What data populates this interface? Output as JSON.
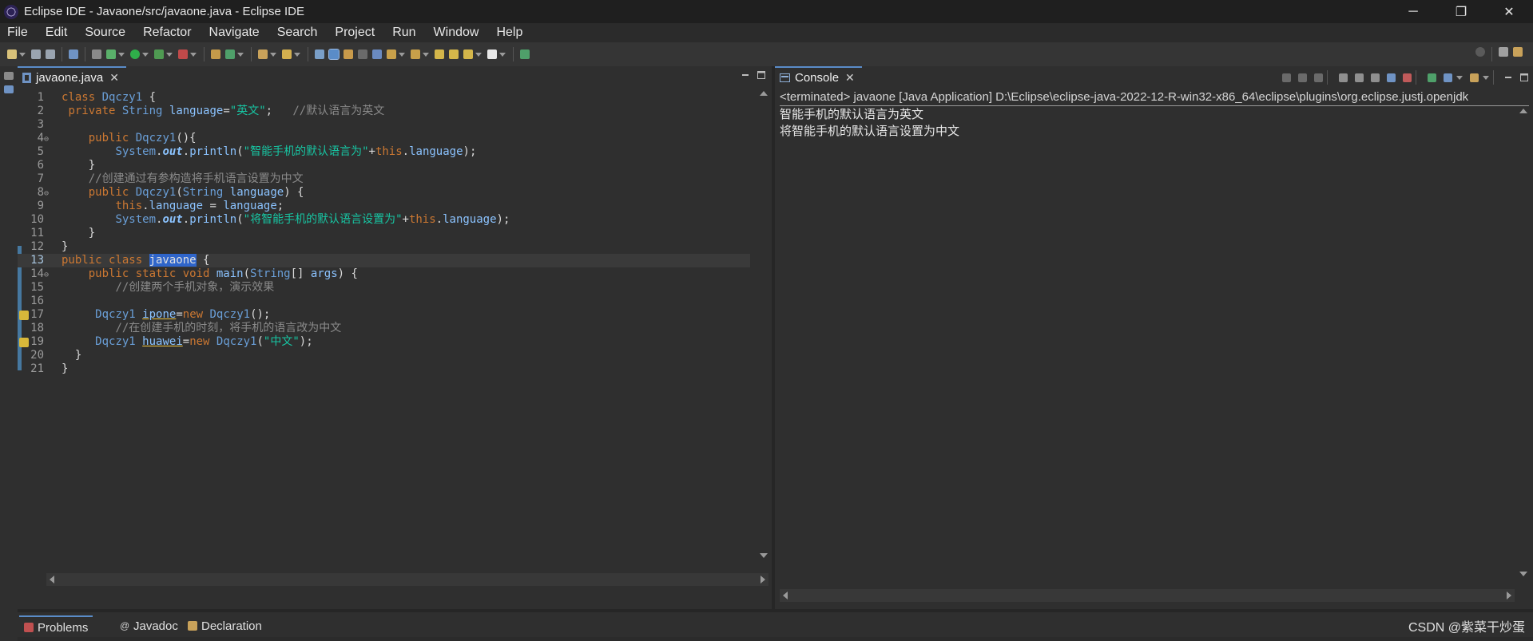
{
  "window": {
    "title": "Eclipse IDE - Javaone/src/javaone.java - Eclipse IDE",
    "min": "─",
    "restore": "❐",
    "close": "✕"
  },
  "menu": [
    "File",
    "Edit",
    "Source",
    "Refactor",
    "Navigate",
    "Search",
    "Project",
    "Run",
    "Window",
    "Help"
  ],
  "editor": {
    "tab_label": "javaone.java",
    "tab_close": "✕"
  },
  "console": {
    "tab_label": "Console",
    "tab_close": "✕",
    "header": "<terminated> javaone [Java Application] D:\\Eclipse\\eclipse-java-2022-12-R-win32-x86_64\\eclipse\\plugins\\org.eclipse.justj.openjdk",
    "output": [
      "智能手机的默认语言为英文",
      "将智能手机的默认语言设置为中文"
    ]
  },
  "bottom_tabs": [
    {
      "label": "Problems",
      "icon": "problems-icon"
    },
    {
      "label": "Javadoc",
      "icon": "at-icon"
    },
    {
      "label": "Declaration",
      "icon": "declaration-icon"
    }
  ],
  "watermark": "CSDN @紫菜干炒蛋",
  "code": [
    {
      "n": "1",
      "segs": [
        [
          "kw",
          "class "
        ],
        [
          "ty",
          "Dqczy1"
        ],
        [
          "",
          " {"
        ]
      ]
    },
    {
      "n": "2",
      "segs": [
        [
          "",
          " "
        ],
        [
          "kw",
          "private "
        ],
        [
          "ty",
          "String "
        ],
        [
          "fld",
          "language"
        ],
        [
          "",
          "="
        ],
        [
          "str",
          "\"英文\""
        ],
        [
          "",
          ";   "
        ],
        [
          "cm",
          "//默认语言为英文"
        ]
      ]
    },
    {
      "n": "3",
      "segs": []
    },
    {
      "n": "4",
      "fold": true,
      "segs": [
        [
          "",
          "    "
        ],
        [
          "kw",
          "public "
        ],
        [
          "ty",
          "Dqczy1"
        ],
        [
          "",
          "(){"
        ]
      ]
    },
    {
      "n": "5",
      "segs": [
        [
          "",
          "        "
        ],
        [
          "ty",
          "System"
        ],
        [
          "",
          "."
        ],
        [
          "stat",
          "out"
        ],
        [
          "",
          "."
        ],
        [
          "fld",
          "println"
        ],
        [
          "",
          "("
        ],
        [
          "str",
          "\"智能手机的默认语言为\""
        ],
        [
          "",
          "+"
        ],
        [
          "kw",
          "this"
        ],
        [
          "",
          "."
        ],
        [
          "fld",
          "language"
        ],
        [
          "",
          ");"
        ]
      ]
    },
    {
      "n": "6",
      "segs": [
        [
          "",
          "    }"
        ]
      ]
    },
    {
      "n": "7",
      "segs": [
        [
          "",
          "    "
        ],
        [
          "cm",
          "//创建通过有参构造将手机语言设置为中文"
        ]
      ]
    },
    {
      "n": "8",
      "fold": true,
      "segs": [
        [
          "",
          "    "
        ],
        [
          "kw",
          "public "
        ],
        [
          "ty",
          "Dqczy1"
        ],
        [
          "",
          "("
        ],
        [
          "ty",
          "String "
        ],
        [
          "fld",
          "language"
        ],
        [
          "",
          ") {"
        ]
      ]
    },
    {
      "n": "9",
      "segs": [
        [
          "",
          "        "
        ],
        [
          "kw",
          "this"
        ],
        [
          "",
          "."
        ],
        [
          "fld",
          "language"
        ],
        [
          "",
          " = "
        ],
        [
          "fld",
          "language"
        ],
        [
          "",
          ";"
        ]
      ]
    },
    {
      "n": "10",
      "segs": [
        [
          "",
          "        "
        ],
        [
          "ty",
          "System"
        ],
        [
          "",
          "."
        ],
        [
          "stat",
          "out"
        ],
        [
          "",
          "."
        ],
        [
          "fld",
          "println"
        ],
        [
          "",
          "("
        ],
        [
          "str",
          "\"将智能手机的默认语言设置为\""
        ],
        [
          "",
          "+"
        ],
        [
          "kw",
          "this"
        ],
        [
          "",
          "."
        ],
        [
          "fld",
          "language"
        ],
        [
          "",
          ");"
        ]
      ]
    },
    {
      "n": "11",
      "segs": [
        [
          "",
          "    }"
        ]
      ]
    },
    {
      "n": "12",
      "segs": [
        [
          "",
          "}"
        ]
      ]
    },
    {
      "n": "13",
      "active": true,
      "segs": [
        [
          "kw",
          "public class "
        ],
        [
          "sel",
          "javaone"
        ],
        [
          "",
          " {"
        ]
      ]
    },
    {
      "n": "14",
      "fold": true,
      "segs": [
        [
          "",
          "    "
        ],
        [
          "kw",
          "public static void "
        ],
        [
          "fld",
          "main"
        ],
        [
          "",
          "("
        ],
        [
          "ty",
          "String"
        ],
        [
          "",
          "[] "
        ],
        [
          "fld",
          "args"
        ],
        [
          "",
          ") {"
        ]
      ]
    },
    {
      "n": "15",
      "segs": [
        [
          "",
          "        "
        ],
        [
          "cm",
          "//创建两个手机对象，演示效果"
        ]
      ]
    },
    {
      "n": "16",
      "segs": []
    },
    {
      "n": "17",
      "warn": true,
      "segs": [
        [
          "",
          "     "
        ],
        [
          "ty",
          "Dqczy1 "
        ],
        [
          "warnv",
          "ipone"
        ],
        [
          "",
          "="
        ],
        [
          "kw",
          "new "
        ],
        [
          "ty",
          "Dqczy1"
        ],
        [
          "",
          "();"
        ]
      ]
    },
    {
      "n": "18",
      "segs": [
        [
          "",
          "        "
        ],
        [
          "cm",
          "//在创建手机的时刻，将手机的语言改为中文"
        ]
      ]
    },
    {
      "n": "19",
      "warn": true,
      "segs": [
        [
          "",
          "     "
        ],
        [
          "ty",
          "Dqczy1 "
        ],
        [
          "warnv",
          "huawei"
        ],
        [
          "",
          "="
        ],
        [
          "kw",
          "new "
        ],
        [
          "ty",
          "Dqczy1"
        ],
        [
          "",
          "("
        ],
        [
          "str",
          "\"中文\""
        ],
        [
          "",
          ");"
        ]
      ]
    },
    {
      "n": "20",
      "segs": [
        [
          "",
          "  }"
        ]
      ]
    },
    {
      "n": "21",
      "segs": [
        [
          "",
          "}"
        ]
      ]
    }
  ]
}
